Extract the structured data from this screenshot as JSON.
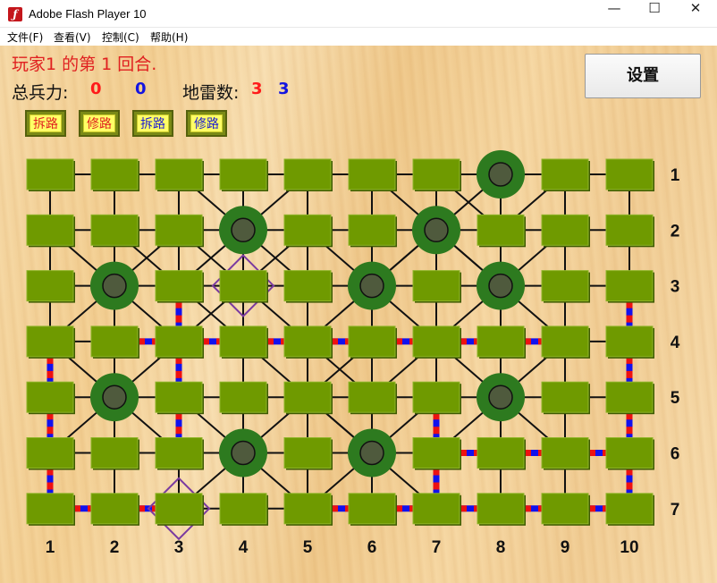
{
  "window": {
    "title": "Adobe Flash Player 10",
    "minimize": "—",
    "maximize": "☐",
    "close": "✕"
  },
  "menu": [
    "文件(F)",
    "查看(V)",
    "控制(C)",
    "帮助(H)"
  ],
  "status": {
    "turn_text": "玩家1  的第  1  回合."
  },
  "stats": {
    "force_label": "总兵力:",
    "force_p1": "0",
    "force_p2": "0",
    "mine_label": "地雷数:",
    "mine_p1": "3",
    "mine_p2": "3"
  },
  "settings_label": "设置",
  "tools": [
    {
      "label": "拆路",
      "color": "red"
    },
    {
      "label": "修路",
      "color": "red"
    },
    {
      "label": "拆路",
      "color": "blue"
    },
    {
      "label": "修路",
      "color": "blue"
    }
  ],
  "colors": {
    "tile": "#6f9a00",
    "tile_dark": "#3e5a00",
    "camp": "#2d7a1f",
    "camp_inner": "#4f5a3d",
    "road": "#111111",
    "diamond": "#7a3aa0",
    "wire_red": "#ee1111",
    "wire_blue": "#1111ee"
  },
  "board": {
    "columns": [
      "1",
      "2",
      "3",
      "4",
      "5",
      "6",
      "7",
      "8",
      "9",
      "10"
    ],
    "rows": [
      "1",
      "2",
      "3",
      "4",
      "5",
      "6",
      "7"
    ],
    "camps": [
      [
        8,
        1
      ],
      [
        4,
        2
      ],
      [
        7,
        2
      ],
      [
        2,
        3
      ],
      [
        6,
        3
      ],
      [
        8,
        3
      ],
      [
        2,
        5
      ],
      [
        8,
        5
      ],
      [
        4,
        6
      ],
      [
        6,
        6
      ]
    ],
    "diamonds": [
      [
        4,
        3
      ],
      [
        3,
        7
      ]
    ],
    "diagonals": [
      [
        [
          1,
          4
        ],
        [
          2,
          5
        ]
      ],
      [
        [
          2,
          5
        ],
        [
          3,
          6
        ]
      ],
      [
        [
          3,
          4
        ],
        [
          2,
          5
        ]
      ],
      [
        [
          2,
          5
        ],
        [
          1,
          6
        ]
      ],
      [
        [
          2,
          2
        ],
        [
          3,
          3
        ]
      ],
      [
        [
          3,
          3
        ],
        [
          4,
          4
        ]
      ],
      [
        [
          1,
          2
        ],
        [
          2,
          3
        ]
      ],
      [
        [
          2,
          3
        ],
        [
          3,
          4
        ]
      ],
      [
        [
          3,
          2
        ],
        [
          2,
          3
        ]
      ],
      [
        [
          2,
          3
        ],
        [
          1,
          4
        ]
      ],
      [
        [
          3,
          1
        ],
        [
          4,
          2
        ]
      ],
      [
        [
          4,
          2
        ],
        [
          5,
          3
        ]
      ],
      [
        [
          5,
          1
        ],
        [
          4,
          2
        ]
      ],
      [
        [
          4,
          2
        ],
        [
          3,
          3
        ]
      ],
      [
        [
          3,
          2
        ],
        [
          4,
          3
        ]
      ],
      [
        [
          4,
          3
        ],
        [
          5,
          4
        ]
      ],
      [
        [
          5,
          2
        ],
        [
          4,
          3
        ]
      ],
      [
        [
          4,
          3
        ],
        [
          3,
          4
        ]
      ],
      [
        [
          5,
          2
        ],
        [
          6,
          3
        ]
      ],
      [
        [
          6,
          3
        ],
        [
          7,
          4
        ]
      ],
      [
        [
          7,
          2
        ],
        [
          6,
          3
        ]
      ],
      [
        [
          6,
          3
        ],
        [
          5,
          4
        ]
      ],
      [
        [
          6,
          1
        ],
        [
          7,
          2
        ]
      ],
      [
        [
          7,
          2
        ],
        [
          8,
          3
        ]
      ],
      [
        [
          8,
          1
        ],
        [
          7,
          2
        ]
      ],
      [
        [
          7,
          2
        ],
        [
          6,
          3
        ]
      ],
      [
        [
          7,
          2
        ],
        [
          8,
          3
        ]
      ],
      [
        [
          8,
          3
        ],
        [
          9,
          4
        ]
      ],
      [
        [
          9,
          2
        ],
        [
          8,
          3
        ]
      ],
      [
        [
          8,
          3
        ],
        [
          7,
          4
        ]
      ],
      [
        [
          7,
          1
        ],
        [
          8,
          2
        ]
      ],
      [
        [
          9,
          1
        ],
        [
          8,
          2
        ]
      ],
      [
        [
          7,
          4
        ],
        [
          8,
          5
        ]
      ],
      [
        [
          8,
          5
        ],
        [
          9,
          6
        ]
      ],
      [
        [
          9,
          4
        ],
        [
          8,
          5
        ]
      ],
      [
        [
          8,
          5
        ],
        [
          7,
          6
        ]
      ],
      [
        [
          3,
          5
        ],
        [
          4,
          6
        ]
      ],
      [
        [
          4,
          6
        ],
        [
          5,
          7
        ]
      ],
      [
        [
          5,
          5
        ],
        [
          4,
          6
        ]
      ],
      [
        [
          4,
          6
        ],
        [
          3,
          7
        ]
      ],
      [
        [
          5,
          5
        ],
        [
          6,
          6
        ]
      ],
      [
        [
          6,
          6
        ],
        [
          7,
          7
        ]
      ],
      [
        [
          7,
          5
        ],
        [
          6,
          6
        ]
      ],
      [
        [
          6,
          6
        ],
        [
          5,
          7
        ]
      ],
      [
        [
          4,
          4
        ],
        [
          5,
          5
        ]
      ],
      [
        [
          5,
          5
        ],
        [
          6,
          6
        ]
      ],
      [
        [
          6,
          4
        ],
        [
          5,
          5
        ]
      ],
      [
        [
          5,
          4
        ],
        [
          6,
          5
        ]
      ],
      [
        [
          7,
          4
        ],
        [
          6,
          5
        ]
      ]
    ],
    "wires_vertical": [
      [
        3,
        3
      ],
      [
        3,
        4
      ],
      [
        3,
        5
      ],
      [
        1,
        4
      ],
      [
        1,
        5
      ],
      [
        1,
        6
      ],
      [
        7,
        5
      ],
      [
        7,
        6
      ],
      [
        10,
        3
      ],
      [
        10,
        4
      ],
      [
        10,
        5
      ],
      [
        10,
        6
      ]
    ],
    "wires_horizontal": [
      [
        2,
        4
      ],
      [
        3,
        4
      ],
      [
        4,
        4
      ],
      [
        5,
        4
      ],
      [
        6,
        4
      ],
      [
        7,
        4
      ],
      [
        8,
        4
      ],
      [
        1,
        7
      ],
      [
        2,
        7
      ],
      [
        5,
        7
      ],
      [
        6,
        7
      ],
      [
        7,
        7
      ],
      [
        8,
        7
      ],
      [
        9,
        7
      ],
      [
        7,
        6
      ],
      [
        8,
        6
      ],
      [
        9,
        6
      ]
    ]
  }
}
